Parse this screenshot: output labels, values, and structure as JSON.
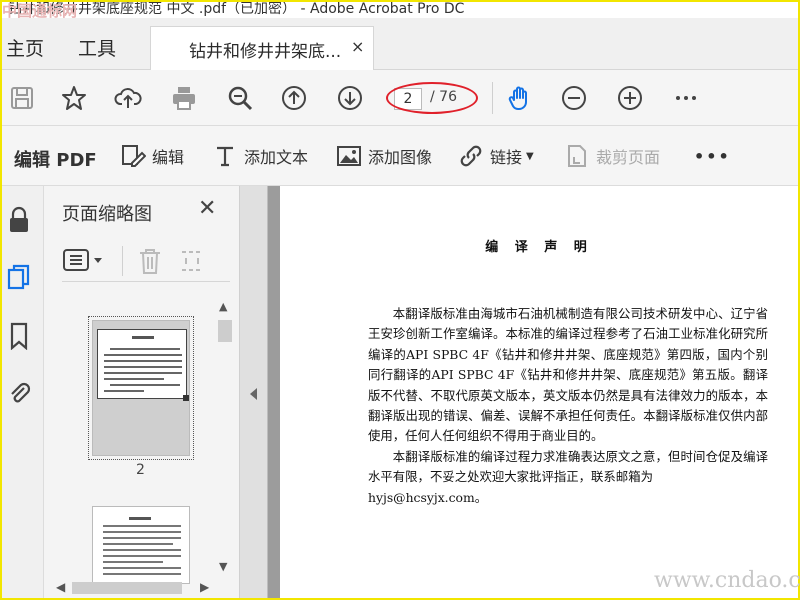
{
  "window": {
    "title": "钻井和修井井架底座规范 中文 .pdf（已加密） - Adobe Acrobat Pro DC",
    "watermark_top": "中国通标网"
  },
  "tabs": {
    "home": "主页",
    "tools": "工具",
    "document": "钻井和修井井架底...",
    "close": "×"
  },
  "toolbar": {
    "icons": [
      "save-icon",
      "star-icon",
      "upload-icon",
      "print-icon",
      "zoom-search-icon",
      "prev-page-icon",
      "next-page-icon",
      "hand-icon",
      "zoom-out-icon",
      "zoom-in-icon",
      "more-icon"
    ],
    "page_current": "2",
    "page_total": "/ 76"
  },
  "edit_toolbar": {
    "title": "编辑 PDF",
    "edit": "编辑",
    "add_text": "添加文本",
    "add_image": "添加图像",
    "link": "链接",
    "crop": "裁剪页面",
    "more": "•••"
  },
  "thumbnails": {
    "title": "页面缩略图",
    "page_label": "2"
  },
  "document": {
    "heading": "编 译 声 明",
    "paragraph1": "本翻译版标准由海城市石油机械制造有限公司技术研发中心、辽宁省王安珍创新工作室编译。本标准的编译过程参考了石油工业标准化研究所编译的API SPBC 4F《钻井和修井井架、底座规范》第四版，国内个别同行翻译的API SPBC 4F《钻井和修井井架、底座规范》第五版。翻译版不代替、不取代原英文版本，英文版本仍然是具有法律效力的版本，本翻译版出现的错误、偏差、误解不承担任何责任。本翻译版标准仅供内部使用，任何人任何组织不得用于商业目的。",
    "paragraph2": "本翻译版标准的编译过程力求准确表达原文之意，但时间仓促及编译水平有限，不妥之处欢迎大家批评指正，联系邮箱为",
    "email": "hyjs@hcsyjx.com。"
  },
  "site_watermark": "www.cndao.com",
  "colors": {
    "highlight_oval": "#e0202a",
    "accent_blue": "#1473e6",
    "border": "#f2e600"
  }
}
